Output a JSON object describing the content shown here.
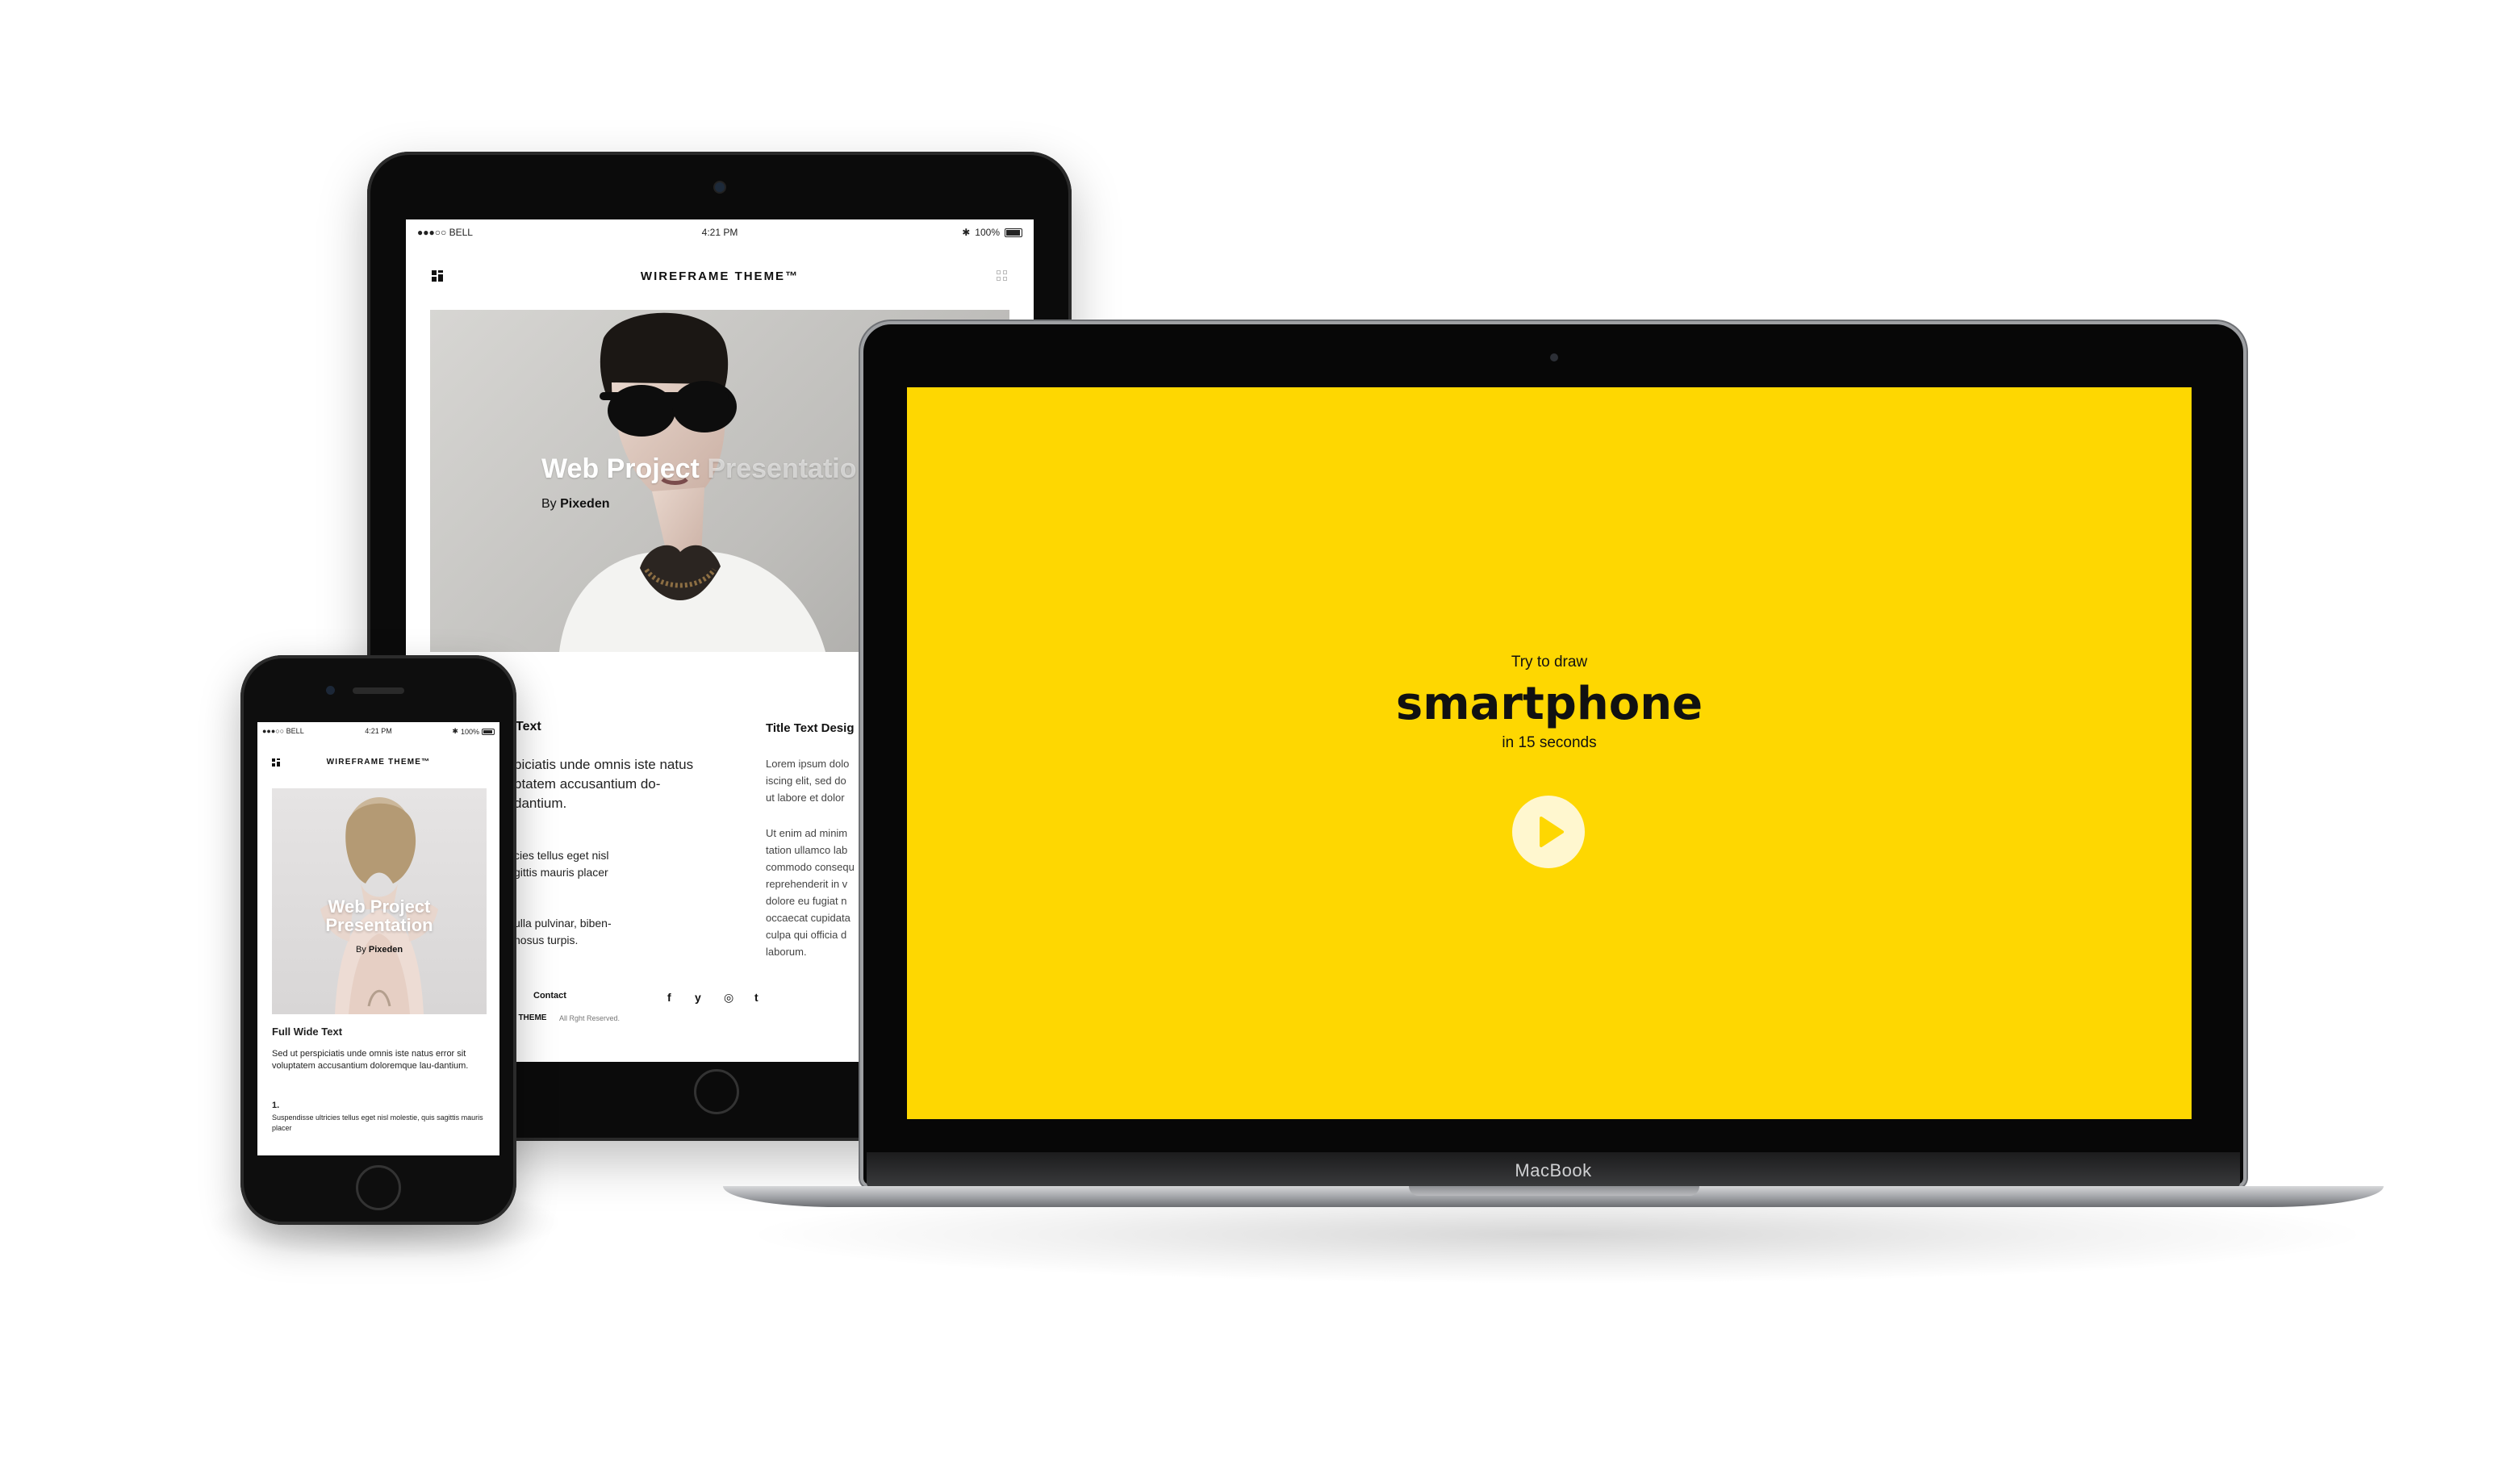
{
  "tablet": {
    "status": {
      "carrier": "●●●○○ BELL",
      "time": "4:21 PM",
      "battery": "100%"
    },
    "header": {
      "title": "WIREFRAME THEME™"
    },
    "hero": {
      "title_visible": "Web Project ",
      "title_faded": "Presentatio",
      "by_label": "By ",
      "author": "Pixeden"
    },
    "column_left": {
      "heading": "Text",
      "lead": [
        "piciatis unde omnis iste natus",
        "ptatem accusantium do-",
        "dantium."
      ],
      "body1": [
        "cies tellus eget nisl",
        "gittis mauris placer"
      ],
      "body2": [
        "ulla pulvinar, biben-",
        "nosus turpis."
      ]
    },
    "column_right": {
      "heading": "Title Text Desig",
      "para1": [
        "Lorem ipsum dolo",
        "iscing elit, sed do",
        "ut labore et dolor"
      ],
      "para2": [
        "Ut enim ad minim",
        "tation ullamco lab",
        "commodo consequ",
        "reprehenderit in v",
        "dolore eu fugiat n",
        "occaecat cupidata",
        "culpa qui officia d",
        "laborum."
      ]
    },
    "footer": {
      "contact": "Contact",
      "brand": "E THEME",
      "rights": "All Rght Reserved.",
      "social": [
        "f",
        "y",
        "◎",
        "t"
      ]
    }
  },
  "phone": {
    "status": {
      "carrier": "●●●○○ BELL",
      "time": "4:21 PM",
      "battery": "100%"
    },
    "header": {
      "title": "WIREFRAME THEME™"
    },
    "hero": {
      "title_line1": "Web Project",
      "title_line2": "Presentation",
      "by_label": "By ",
      "author": "Pixeden"
    },
    "section_title": "Full Wide Text",
    "paragraph": "Sed ut perspiciatis unde omnis iste natus error sit voluptatem accusantium doloremque lau-dantium.",
    "list_number": "1.",
    "list_text": "Suspendisse ultricies tellus eget nisl molestie, quis sagittis mauris placer"
  },
  "laptop": {
    "brand_label": "MacBook",
    "screen": {
      "line_top": "Try to draw",
      "line_main": "smartphone",
      "line_bottom": "in 15 seconds",
      "accent_color": "#fed701"
    },
    "play_button_icon": "play-icon"
  }
}
